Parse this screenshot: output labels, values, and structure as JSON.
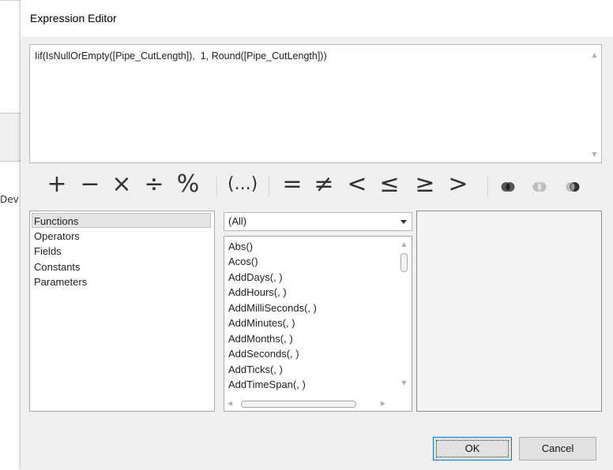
{
  "background": {
    "partial_label": "Dev"
  },
  "dialog": {
    "title": "Expression Editor",
    "expression": "Iif(IsNullOrEmpty([Pipe_CutLength]),  1, Round([Pipe_CutLength]))",
    "operators": [
      "+",
      "−",
      "×",
      "÷",
      "%",
      "(...)",
      "=",
      "≠",
      "<",
      "≤",
      "≥",
      ">"
    ],
    "logic_icons": [
      "and-icon",
      "or-icon",
      "not-icon"
    ],
    "categories": [
      "Functions",
      "Operators",
      "Fields",
      "Constants",
      "Parameters"
    ],
    "selected_category": "Functions",
    "filter_value": "(All)",
    "functions": [
      "Abs()",
      "Acos()",
      "AddDays(, )",
      "AddHours(, )",
      "AddMilliSeconds(, )",
      "AddMinutes(, )",
      "AddMonths(, )",
      "AddSeconds(, )",
      "AddTicks(, )",
      "AddTimeSpan(, )"
    ],
    "description": "",
    "ok_label": "OK",
    "cancel_label": "Cancel"
  }
}
